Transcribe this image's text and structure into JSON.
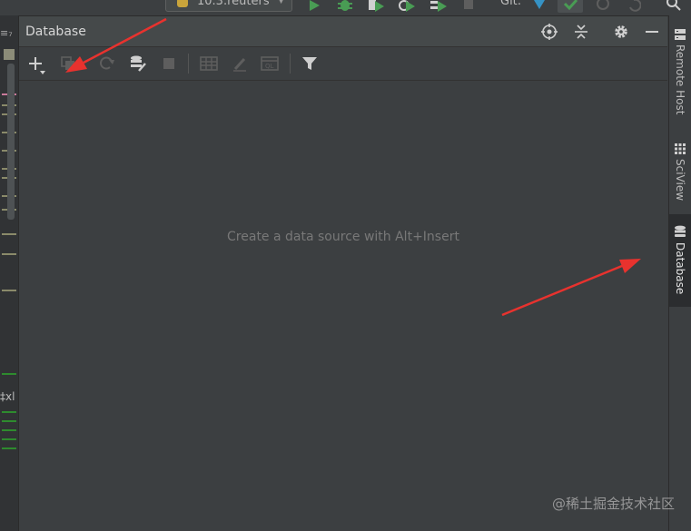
{
  "top_toolbar": {
    "run_config": "10.3.reuters",
    "git_label": "Git:"
  },
  "database_panel": {
    "title": "Database",
    "empty_hint": "Create a data source with Alt+Insert",
    "header_icons": [
      "target-icon",
      "collapse-all-icon",
      "gear-icon",
      "minimize-icon"
    ],
    "toolbar_icons": [
      "plus-icon",
      "copy-icon",
      "refresh-icon",
      "data-source-properties-icon",
      "stop-icon",
      "table-icon",
      "edit-icon",
      "console-icon",
      "filter-icon"
    ]
  },
  "right_stripe": {
    "items": [
      {
        "label": "Remote Host",
        "icon": "server-icon",
        "active": false
      },
      {
        "label": "SciView",
        "icon": "grid-icon",
        "active": false
      },
      {
        "label": "Database",
        "icon": "database-icon",
        "active": true
      }
    ]
  },
  "left_strip": {
    "glyph": "≡₇",
    "fragment": "‡xl"
  },
  "watermark": "@稀土掘金技术社区",
  "colors": {
    "background": "#3c3f41",
    "header": "#45494a",
    "active_stripe": "#2b2d2f",
    "arrow": "#e8322e",
    "run_green": "#499c54"
  }
}
